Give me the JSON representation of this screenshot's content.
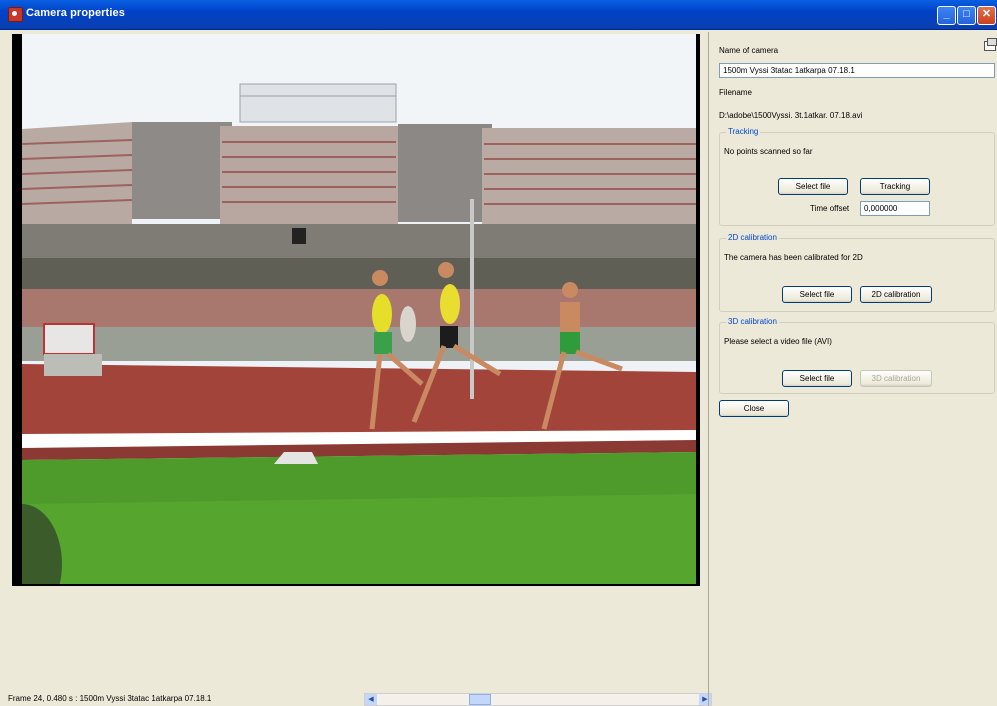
{
  "window": {
    "title": "Camera properties",
    "minimize_glyph": "_",
    "maximize_glyph": "□",
    "close_glyph": "✕"
  },
  "statusbar": {
    "text": "Frame 24, 0.480 s : 1500m Vyssi 3tatac 1atkarpa 07.18.1",
    "left_arrow": "◀",
    "right_arrow": "▶"
  },
  "panel": {
    "name_label": "Name of camera",
    "name_value": "1500m Vyssi 3tatac 1atkarpa 07.18.1",
    "filename_label": "Filename",
    "filename_value": "D:\\adobe\\1500Vyssi. 3t.1atkar. 07.18.avi",
    "tracking": {
      "legend": "Tracking",
      "status": "No points scanned so far",
      "select_file": "Select file",
      "tracking_button": "Tracking",
      "time_offset_label": "Time offset",
      "time_offset_value": "0,000000"
    },
    "calib2d": {
      "legend": "2D calibration",
      "status": "The camera has been calibrated for 2D",
      "select_file": "Select file",
      "calib_button": "2D calibration"
    },
    "calib3d": {
      "legend": "3D calibration",
      "status": "Please select a video file (AVI)",
      "select_file": "Select file",
      "calib_button": "3D calibration"
    },
    "close_button": "Close"
  },
  "icons": [
    "app-icon",
    "minimize-icon",
    "maximize-icon",
    "close-icon",
    "copy-icon",
    "scroll-left-icon",
    "scroll-right-icon"
  ]
}
